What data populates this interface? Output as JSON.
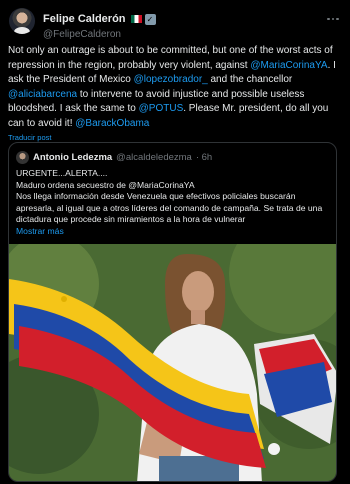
{
  "author": {
    "name": "Felipe Calderón",
    "handle": "@FelipeCalderon"
  },
  "tweet": {
    "segments": [
      {
        "text": "Not only an outrage is about to be committed, but one of the worst acts of repression in the region, probably very violent, against ",
        "type": "text"
      },
      {
        "text": "@MariaCorinaYA",
        "type": "mention"
      },
      {
        "text": ".  I ask the President of Mexico ",
        "type": "text"
      },
      {
        "text": "@lopezobrador_",
        "type": "mention"
      },
      {
        "text": " and the chancellor ",
        "type": "text"
      },
      {
        "text": "@aliciabarcena",
        "type": "mention"
      },
      {
        "text": " to intervene to avoid injustice and possible useless bloodshed.  I ask the same to ",
        "type": "text"
      },
      {
        "text": "@POTUS",
        "type": "mention"
      },
      {
        "text": ". Please Mr. president, do all you can to avoid it! ",
        "type": "text"
      },
      {
        "text": "@BarackObama",
        "type": "mention"
      }
    ],
    "translate_label": "Traducir post"
  },
  "quote": {
    "name": "Antonio Ledezma",
    "handle": "@alcaldeledezma",
    "time": "· 6h",
    "line1": "URGENTE...ALERTA....",
    "line2": "Maduro ordena secuestro de @MariaCorinaYA",
    "line3": "Nos llega información desde Venezuela que efectivos policiales buscarán apresarla, al igual que a otros líderes del comando de campaña. Se trata de una dictadura que procede sin miramientos a la hora de vulnerar",
    "show_more": "Mostrar más"
  },
  "icons": {
    "more": "more-options-icon",
    "verified": "verified-badge-icon",
    "flag": "mexico-flag-icon"
  }
}
